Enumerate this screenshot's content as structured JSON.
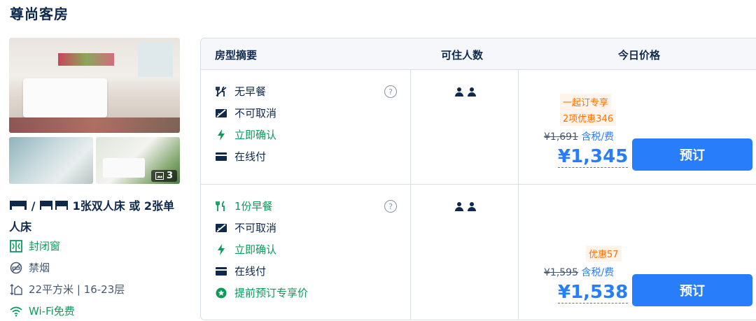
{
  "title": "尊尚客房",
  "photos": {
    "count": "3"
  },
  "room": {
    "bed_text": "1张双人床 或 2张单人床",
    "features": [
      {
        "icon": "window-icon",
        "text": "封闭窗",
        "color": "#0a9a5a"
      },
      {
        "icon": "no-smoking-icon",
        "text": "禁烟",
        "color": "#455873"
      },
      {
        "icon": "area-icon",
        "text": "22平方米 | 16-23层",
        "color": "#455873"
      },
      {
        "icon": "wifi-icon",
        "text": "Wi-Fi免费",
        "color": "#0a9a5a"
      }
    ]
  },
  "table": {
    "headers": {
      "summary": "房型摘要",
      "guests": "可住人数",
      "price": "今日价格"
    }
  },
  "rows": [
    {
      "items": [
        {
          "icon": "no-breakfast-icon",
          "text": "无早餐",
          "color": "#0f294d"
        },
        {
          "icon": "no-cancel-icon",
          "text": "不可取消",
          "color": "#0f294d"
        },
        {
          "icon": "lightning-icon",
          "text": "立即确认",
          "color": "#0a9a5a"
        },
        {
          "icon": "card-icon",
          "text": "在线付",
          "color": "#0f294d"
        }
      ],
      "promos": [
        "一起订专享",
        "2项优惠346"
      ],
      "original_price": "¥1,691",
      "tax_label": "含税/费",
      "price": "¥1,345",
      "book_label": "预订"
    },
    {
      "items": [
        {
          "icon": "breakfast-icon",
          "text": "1份早餐",
          "color": "#0a9a5a"
        },
        {
          "icon": "no-cancel-icon",
          "text": "不可取消",
          "color": "#0f294d"
        },
        {
          "icon": "lightning-icon",
          "text": "立即确认",
          "color": "#0a9a5a"
        },
        {
          "icon": "card-icon",
          "text": "在线付",
          "color": "#0f294d"
        },
        {
          "icon": "star-badge-icon",
          "text": "提前预订专享价",
          "color": "#0a9a5a"
        }
      ],
      "promos": [
        "优惠57"
      ],
      "original_price": "¥1,595",
      "tax_label": "含税/费",
      "price": "¥1,538",
      "book_label": "预订"
    }
  ],
  "colors": {
    "accent": "#287dfa",
    "green": "#0a9a5a",
    "promo": "#ff6f00",
    "text": "#0f294d"
  }
}
